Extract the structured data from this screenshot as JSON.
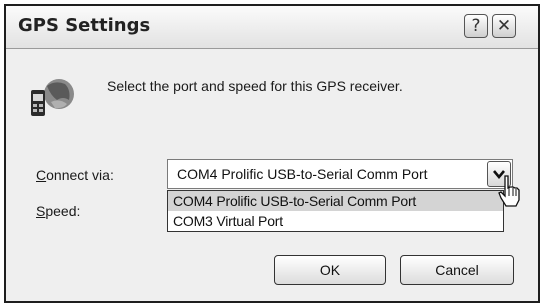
{
  "window": {
    "title": "GPS Settings",
    "help_glyph": "?",
    "close_glyph": "✕"
  },
  "intro_text": "Select the port and speed for this GPS receiver.",
  "connect": {
    "label_accel": "C",
    "label_rest": "onnect via:",
    "value": "COM4 Prolific USB-to-Serial Comm Port",
    "options": [
      "COM4 Prolific USB-to-Serial Comm Port",
      "COM3 Virtual Port"
    ],
    "selected_index": 0
  },
  "speed": {
    "label_accel": "S",
    "label_rest": "peed:"
  },
  "buttons": {
    "ok": "OK",
    "cancel": "Cancel"
  },
  "icons": [
    "gps-receiver-icon",
    "help-icon",
    "close-icon",
    "chevron-down-icon",
    "mouse-pointer-icon"
  ]
}
